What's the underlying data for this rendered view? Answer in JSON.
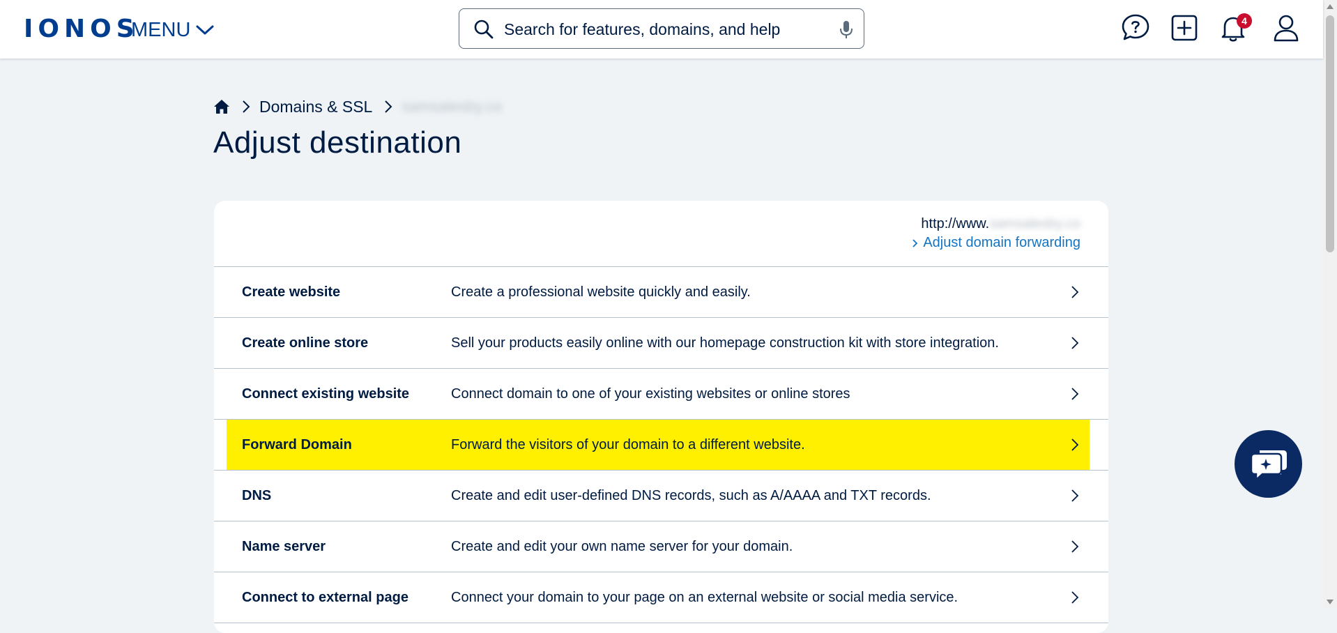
{
  "header": {
    "logo": "IONOS",
    "menu_label": "MENU",
    "search_placeholder": "Search for features, domains, and help",
    "notification_count": "4"
  },
  "breadcrumb": {
    "items": [
      "Domains & SSL"
    ],
    "redacted_domain": "samsalesby.co"
  },
  "page": {
    "title": "Adjust destination"
  },
  "destination": {
    "url_prefix": "http://www.",
    "url_redacted": "samsalesby.co",
    "adjust_link": "Adjust domain forwarding"
  },
  "options": [
    {
      "title": "Create website",
      "description": "Create a professional website quickly and easily.",
      "highlighted": false
    },
    {
      "title": "Create online store",
      "description": "Sell your products easily online with our homepage construction kit with store integration.",
      "highlighted": false
    },
    {
      "title": "Connect existing website",
      "description": "Connect domain to one of your existing websites or online stores",
      "highlighted": false
    },
    {
      "title": "Forward Domain",
      "description": "Forward the visitors of your domain to a different website.",
      "highlighted": true
    },
    {
      "title": "DNS",
      "description": "Create and edit user-defined DNS records, such as A/AAAA and TXT records.",
      "highlighted": false
    },
    {
      "title": "Name server",
      "description": "Create and edit your own name server for your domain.",
      "highlighted": false
    },
    {
      "title": "Connect to external page",
      "description": "Connect your domain to your page on an external website or social media service.",
      "highlighted": false
    }
  ],
  "colors": {
    "brand": "#003d8f",
    "text": "#001b41",
    "link": "#1474c4",
    "highlight": "#fff000",
    "background": "#eff3f6",
    "chat_fab": "#0b2a63",
    "badge": "#c8102e"
  },
  "icons": {
    "header": [
      "search-icon",
      "microphone-icon",
      "help-icon",
      "add-icon",
      "notification-bell-icon",
      "user-icon"
    ],
    "chat": "chat-assistant-icon"
  }
}
